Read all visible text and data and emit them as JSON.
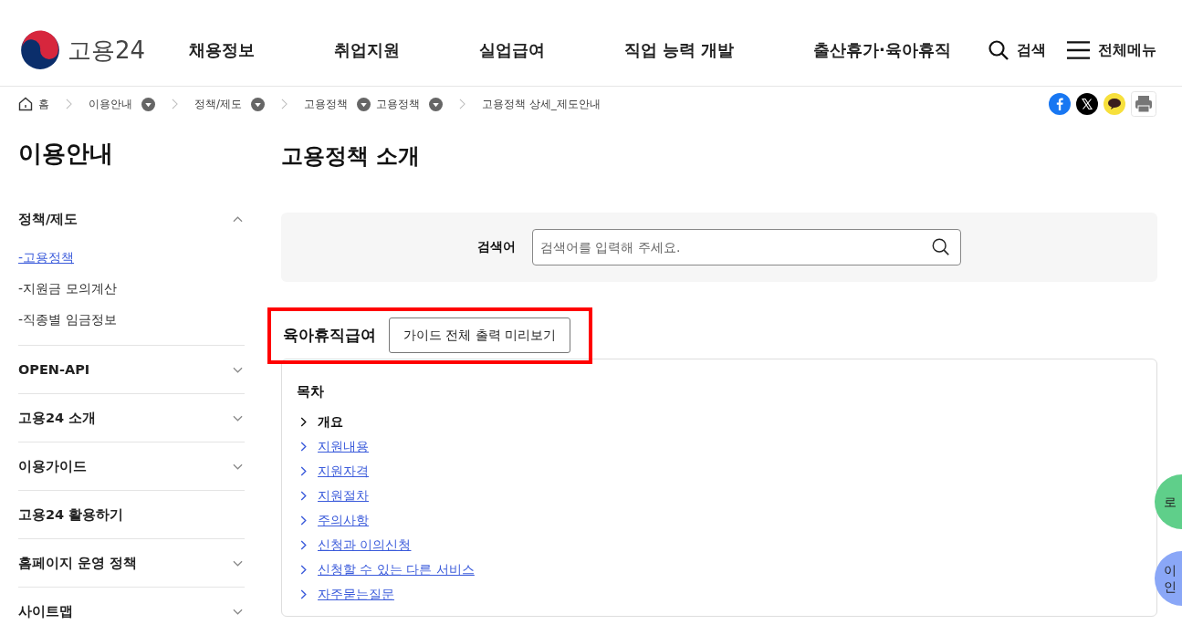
{
  "header": {
    "logo_text": "고용24",
    "nav": [
      "채용정보",
      "취업지원",
      "실업급여",
      "직업 능력 개발",
      "출산휴가·육아휴직"
    ],
    "search_label": "검색",
    "menu_label": "전체메뉴"
  },
  "breadcrumb": [
    {
      "label": "홈",
      "kind": "home"
    },
    {
      "label": "이용안내",
      "kind": "dropdown"
    },
    {
      "label": "정책/제도",
      "kind": "dropdown"
    },
    {
      "label": "고용정책",
      "kind": "dropdown-pair",
      "second": "고용정책"
    },
    {
      "label": "고용정책 상세_제도안내",
      "kind": "current"
    }
  ],
  "share": [
    {
      "kind": "facebook"
    },
    {
      "kind": "x"
    },
    {
      "kind": "kakao"
    },
    {
      "kind": "print"
    }
  ],
  "sidebar": {
    "title": "이용안내",
    "items": [
      {
        "label": "정책/제도",
        "kind": "group",
        "expanded": true,
        "children": [
          {
            "label": "-고용정책",
            "selected": true
          },
          {
            "label": "-지원금 모의계산",
            "selected": false
          },
          {
            "label": "-직종별 임금정보",
            "selected": false
          }
        ]
      },
      {
        "label": "OPEN-API",
        "kind": "group",
        "expanded": false
      },
      {
        "label": "고용24 소개",
        "kind": "group",
        "expanded": false
      },
      {
        "label": "이용가이드",
        "kind": "group",
        "expanded": false
      },
      {
        "label": "고용24 활용하기",
        "kind": "link"
      },
      {
        "label": "홈페이지 운영 정책",
        "kind": "group",
        "expanded": false
      },
      {
        "label": "사이트맵",
        "kind": "group",
        "expanded": false
      }
    ]
  },
  "main": {
    "title": "고용정책 소개",
    "search": {
      "label": "검색어",
      "placeholder": "검색어를 입력해 주세요."
    },
    "section": {
      "title": "육아휴직급여",
      "button": "가이드 전체 출력 미리보기",
      "highlighted": true
    },
    "toc": {
      "title": "목차",
      "items": [
        {
          "label": "개요",
          "selected": true
        },
        {
          "label": "지원내용",
          "selected": false
        },
        {
          "label": "지원자격",
          "selected": false
        },
        {
          "label": "지원절차",
          "selected": false
        },
        {
          "label": "주의사항",
          "selected": false
        },
        {
          "label": "신청과 이의신청",
          "selected": false
        },
        {
          "label": "신청할 수 있는 다른 서비스",
          "selected": false
        },
        {
          "label": "자주묻는질문",
          "selected": false
        }
      ]
    }
  },
  "floating": [
    {
      "label": "로",
      "color": "#5fcf8a"
    },
    {
      "label": "이",
      "label2": "인",
      "color": "#8aa7f7"
    }
  ]
}
